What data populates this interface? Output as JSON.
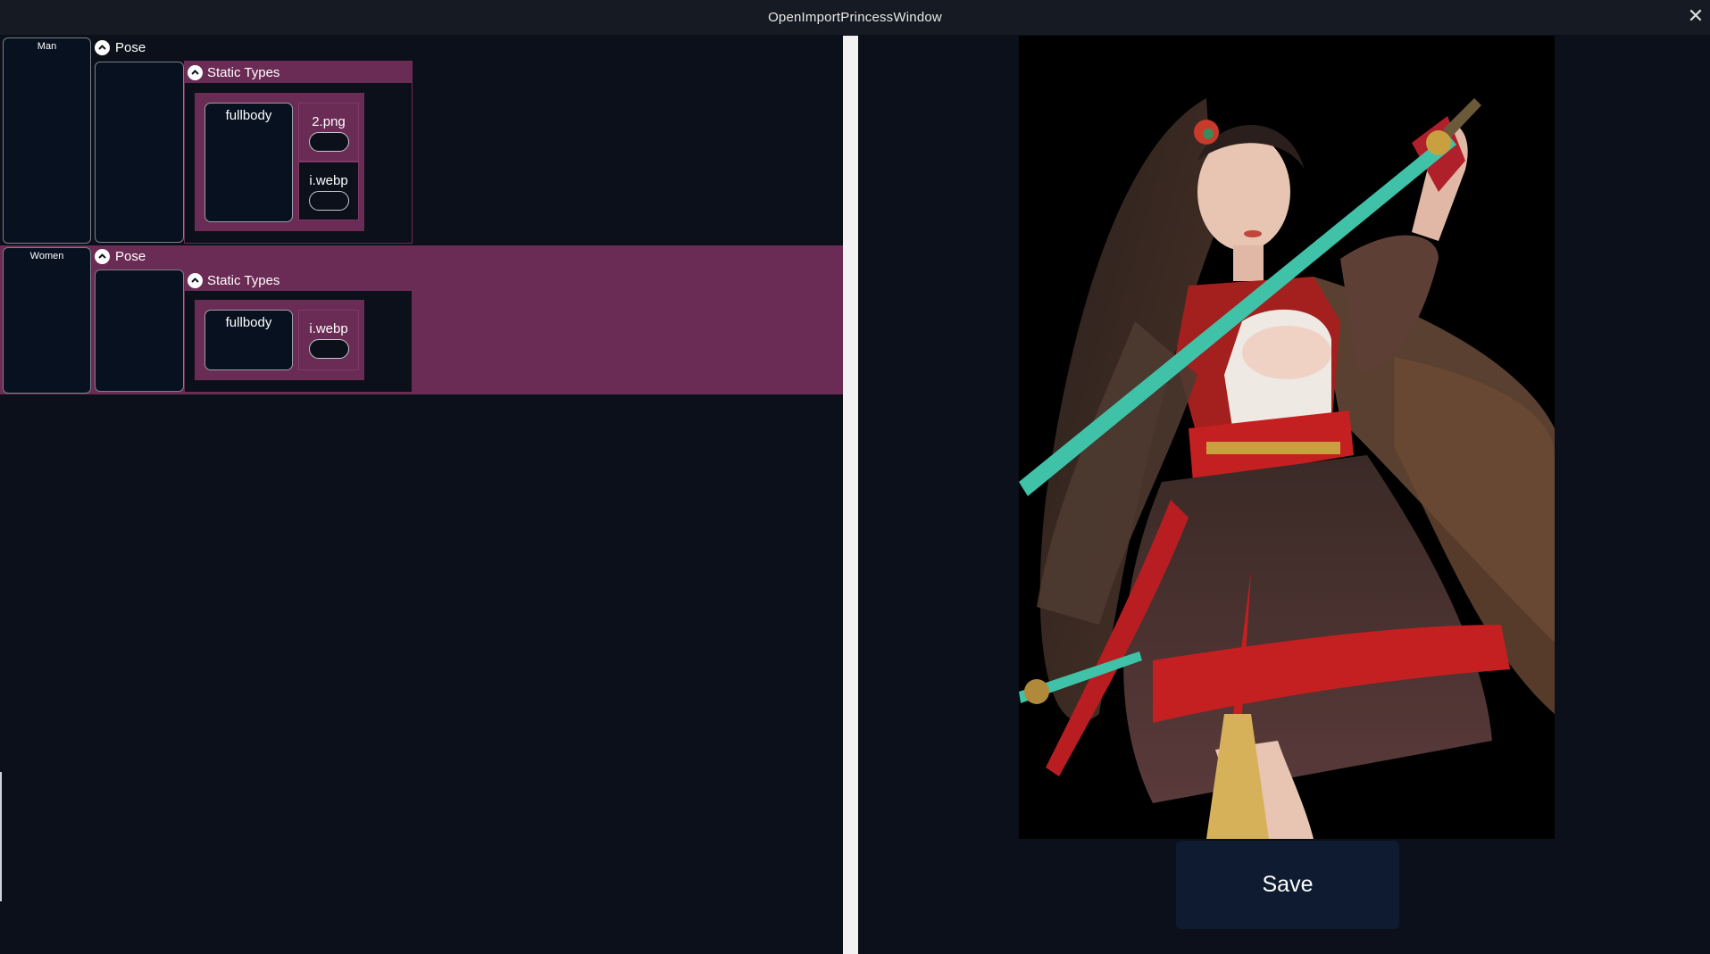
{
  "window": {
    "title": "OpenImportPrincessWindow",
    "close_icon": "close-icon"
  },
  "groups": [
    {
      "category": "Man",
      "pose_label": "Pose",
      "static_label": "Static Types",
      "folder": "fullbody",
      "files": [
        "2.png",
        "i.webp"
      ]
    },
    {
      "category": "Women",
      "pose_label": "Pose",
      "static_label": "Static Types",
      "folder": "fullbody",
      "files": [
        "i.webp"
      ]
    }
  ],
  "preview": {
    "save_label": "Save"
  },
  "colors": {
    "accent": "#6a2b55",
    "background": "#0b101a",
    "card": "#07111f",
    "save_button": "#0e1b30"
  }
}
